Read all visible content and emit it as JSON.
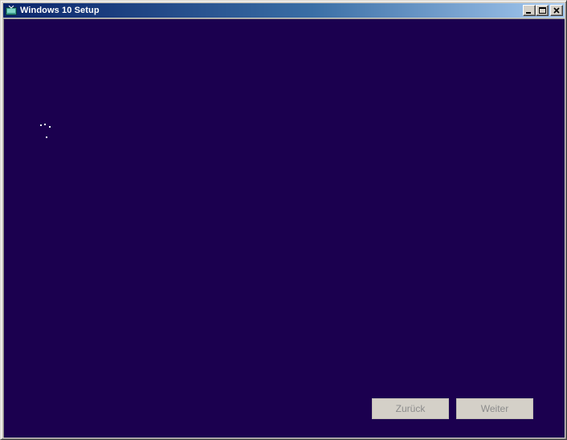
{
  "window": {
    "title": "Windows 10 Setup",
    "controls": {
      "minimize_icon": "minimize-icon",
      "maximize_icon": "maximize-icon",
      "close_icon": "close-icon"
    }
  },
  "client": {
    "background_color": "#1b004f",
    "loading_icon": "loading-spinner-icon"
  },
  "buttons": {
    "back_label": "Zurück",
    "next_label": "Weiter"
  }
}
